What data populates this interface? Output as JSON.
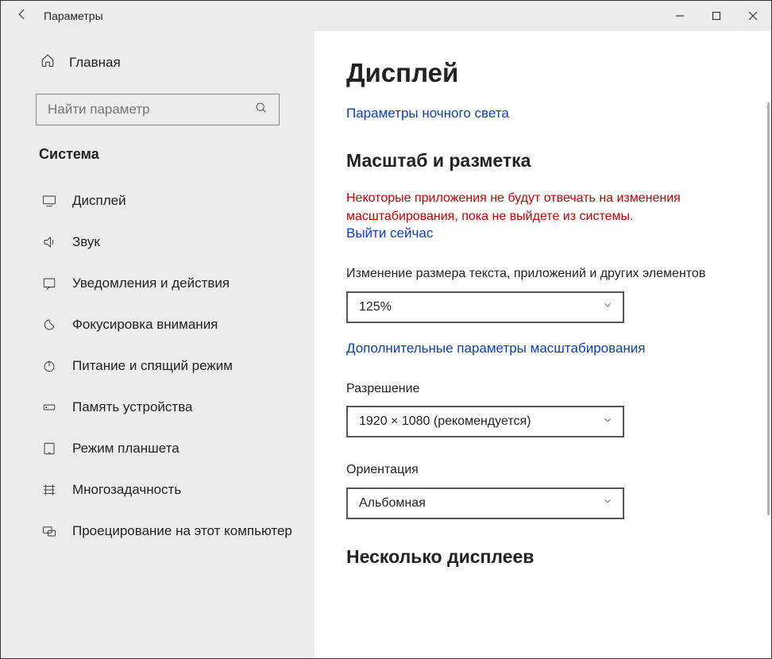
{
  "window": {
    "title": "Параметры"
  },
  "sidebar": {
    "home": "Главная",
    "search_placeholder": "Найти параметр",
    "category": "Система",
    "items": [
      {
        "label": "Дисплей"
      },
      {
        "label": "Звук"
      },
      {
        "label": "Уведомления и действия"
      },
      {
        "label": "Фокусировка внимания"
      },
      {
        "label": "Питание и спящий режим"
      },
      {
        "label": "Память устройства"
      },
      {
        "label": "Режим планшета"
      },
      {
        "label": "Многозадачность"
      },
      {
        "label": "Проецирование на этот компьютер"
      }
    ]
  },
  "content": {
    "title": "Дисплей",
    "night_light_link": "Параметры ночного света",
    "scale_heading": "Масштаб и разметка",
    "scale_warning": "Некоторые приложения не будут отвечать на изменения масштабирования, пока не выйдете из системы.",
    "signout_link": "Выйти сейчас",
    "scale_label": "Изменение размера текста, приложений и других элементов",
    "scale_value": "125%",
    "advanced_scale_link": "Дополнительные параметры масштабирования",
    "resolution_label": "Разрешение",
    "resolution_value": "1920 × 1080 (рекомендуется)",
    "orientation_label": "Ориентация",
    "orientation_value": "Альбомная",
    "multi_heading": "Несколько дисплеев"
  }
}
